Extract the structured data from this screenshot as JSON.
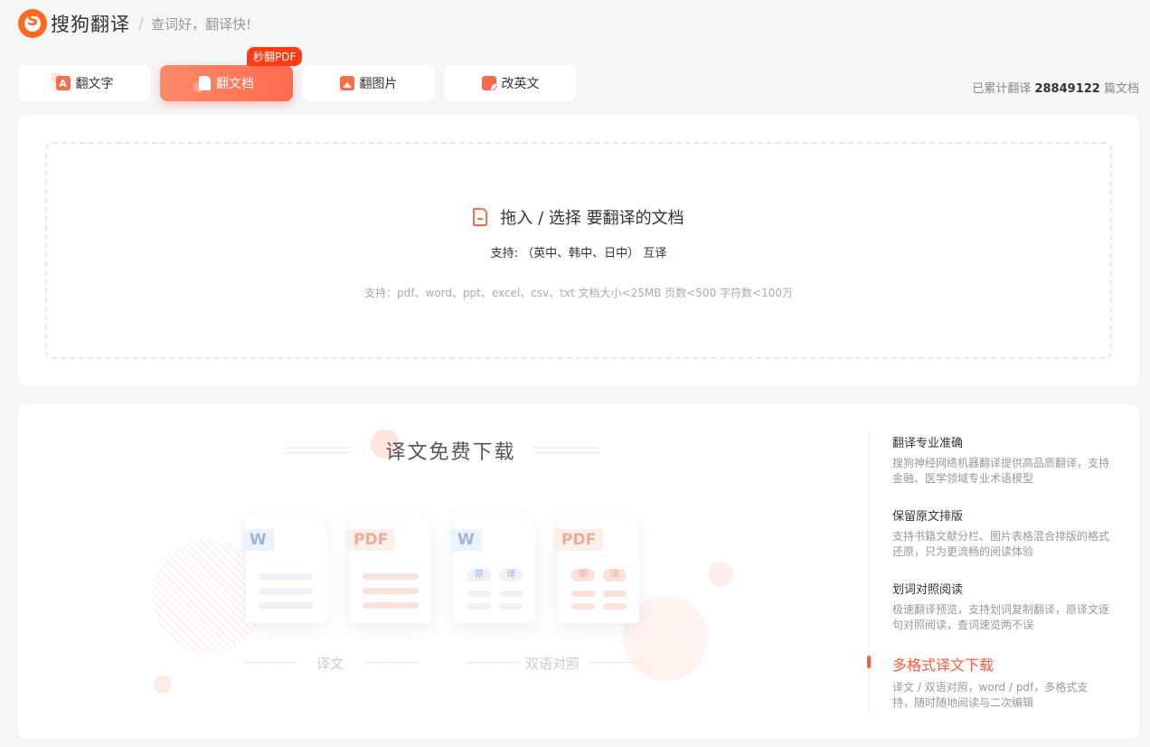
{
  "header": {
    "brand": "搜狗翻译",
    "separator": "/",
    "slogan": "查词好，翻译快!"
  },
  "tabs": [
    {
      "label": "翻文字",
      "icon": "text-translate-icon",
      "active": false
    },
    {
      "label": "翻文档",
      "icon": "document-icon",
      "active": true,
      "badge": "秒翻PDF"
    },
    {
      "label": "翻图片",
      "icon": "image-icon",
      "active": false
    },
    {
      "label": "改英文",
      "icon": "correct-english-icon",
      "active": false
    }
  ],
  "counter": {
    "prefix": "已累计翻译",
    "value": "28849122",
    "suffix": "篇文档"
  },
  "upload": {
    "title": "拖入 / 选择 要翻译的文档",
    "languages": "支持: （英中、韩中、日中） 互译",
    "formats": "支持：pdf、word、ppt、excel、csv、txt    文档大小<25MB 页数<500 字符数<100万"
  },
  "illustration": {
    "title": "译文免费下载",
    "cards": [
      {
        "tag": "W",
        "type": "word"
      },
      {
        "tag": "PDF",
        "type": "pdf"
      },
      {
        "tag": "W",
        "type": "word",
        "left_label": "原",
        "right_label": "译"
      },
      {
        "tag": "PDF",
        "type": "pdf",
        "left_label": "原",
        "right_label": "译"
      }
    ],
    "caption_translation": "译文",
    "caption_bilingual": "双语对照"
  },
  "features": [
    {
      "title": "翻译专业准确",
      "desc": "搜狗神经网络机器翻译提供高品质翻译，支持金融、医学领域专业术语模型",
      "active": false
    },
    {
      "title": "保留原文排版",
      "desc": "支持书籍文献分栏、图片表格混合排版的格式还原，只为更流畅的阅读体验",
      "active": false
    },
    {
      "title": "划词对照阅读",
      "desc": "极速翻译预览，支持划词复制翻译，原译文逐句对照阅读，查词速览两不误",
      "active": false
    },
    {
      "title": "多格式译文下载",
      "desc": "译文 / 双语对照，word / pdf，多格式支持，随时随地阅读与二次编辑",
      "active": true
    }
  ],
  "colors": {
    "accent": "#ff6b4d",
    "badge": "#ff3d15",
    "active_feature": "#ff5a3c"
  }
}
